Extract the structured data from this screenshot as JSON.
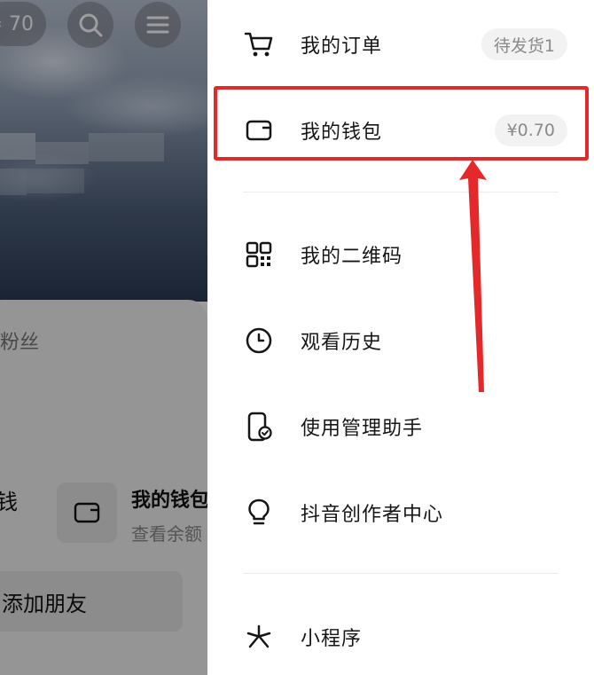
{
  "background": {
    "counter_text": "≠ 70",
    "fans_label": "粉丝",
    "partial_label": "钱",
    "wallet_card": {
      "title": "我的钱包",
      "subtitle": "查看余额"
    },
    "add_friend_label": "添加朋友"
  },
  "menu": {
    "items": [
      {
        "label": "我的订单",
        "icon": "cart-icon",
        "badge": "待发货1"
      },
      {
        "label": "我的钱包",
        "icon": "wallet-icon",
        "badge": "¥0.70"
      },
      {
        "label": "我的二维码",
        "icon": "qrcode-icon"
      },
      {
        "label": "观看历史",
        "icon": "clock-icon"
      },
      {
        "label": "使用管理助手",
        "icon": "phone-check-icon"
      },
      {
        "label": "抖音创作者中心",
        "icon": "lightbulb-icon"
      },
      {
        "label": "小程序",
        "icon": "miniprogram-icon"
      }
    ]
  },
  "annotation": {
    "highlight_color": "#e5292b"
  }
}
